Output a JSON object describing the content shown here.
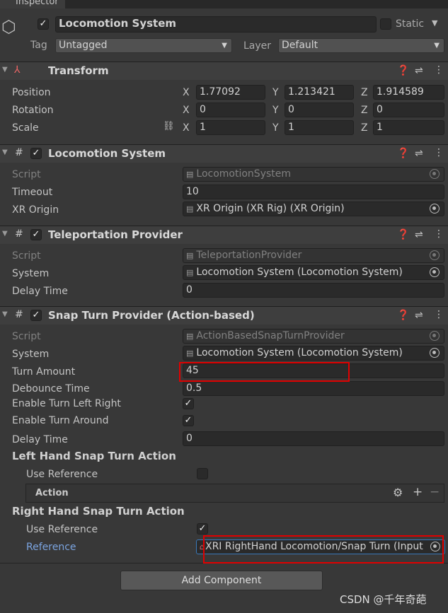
{
  "tab": {
    "label": "Inspector"
  },
  "object": {
    "name": "Locomotion System",
    "static_label": "Static",
    "tag_label": "Tag",
    "tag": "Untagged",
    "layer_label": "Layer",
    "layer": "Default"
  },
  "transform": {
    "title": "Transform",
    "position_label": "Position",
    "rotation_label": "Rotation",
    "scale_label": "Scale",
    "position": [
      "1.77092",
      "1.213421",
      "1.914589"
    ],
    "rotation": [
      "0",
      "0",
      "0"
    ],
    "scale": [
      "1",
      "1",
      "1"
    ],
    "axes": [
      "X",
      "Y",
      "Z"
    ]
  },
  "locomotion": {
    "title": "Locomotion System",
    "script_label": "Script",
    "script": "LocomotionSystem",
    "timeout_label": "Timeout",
    "timeout": "10",
    "xr_origin_label": "XR Origin",
    "xr_origin": "XR Origin (XR Rig) (XR Origin)"
  },
  "teleport": {
    "title": "Teleportation Provider",
    "script_label": "Script",
    "script": "TeleportationProvider",
    "system_label": "System",
    "system": "Locomotion System (Locomotion System)",
    "delay_label": "Delay Time",
    "delay": "0"
  },
  "snap": {
    "title": "Snap Turn Provider (Action-based)",
    "script_label": "Script",
    "script": "ActionBasedSnapTurnProvider",
    "system_label": "System",
    "system": "Locomotion System (Locomotion System)",
    "turn_amount_label": "Turn Amount",
    "turn_amount": "45",
    "debounce_label": "Debounce Time",
    "debounce": "0.5",
    "enable_lr_label": "Enable Turn Left Right",
    "enable_lr": true,
    "enable_around_label": "Enable Turn Around",
    "enable_around": true,
    "delay_label": "Delay Time",
    "delay": "0",
    "left_title": "Left Hand Snap Turn Action",
    "left_use_ref_label": "Use Reference",
    "left_use_ref": false,
    "action_label": "Action",
    "right_title": "Right Hand Snap Turn Action",
    "right_use_ref_label": "Use Reference",
    "right_use_ref": true,
    "reference_label": "Reference",
    "reference": "XRI RightHand Locomotion/Snap Turn (Input"
  },
  "add_component": "Add Component",
  "watermark": "CSDN @千年奇葩",
  "colors": {
    "highlight": "#e00000",
    "link": "#7ba4e0"
  }
}
